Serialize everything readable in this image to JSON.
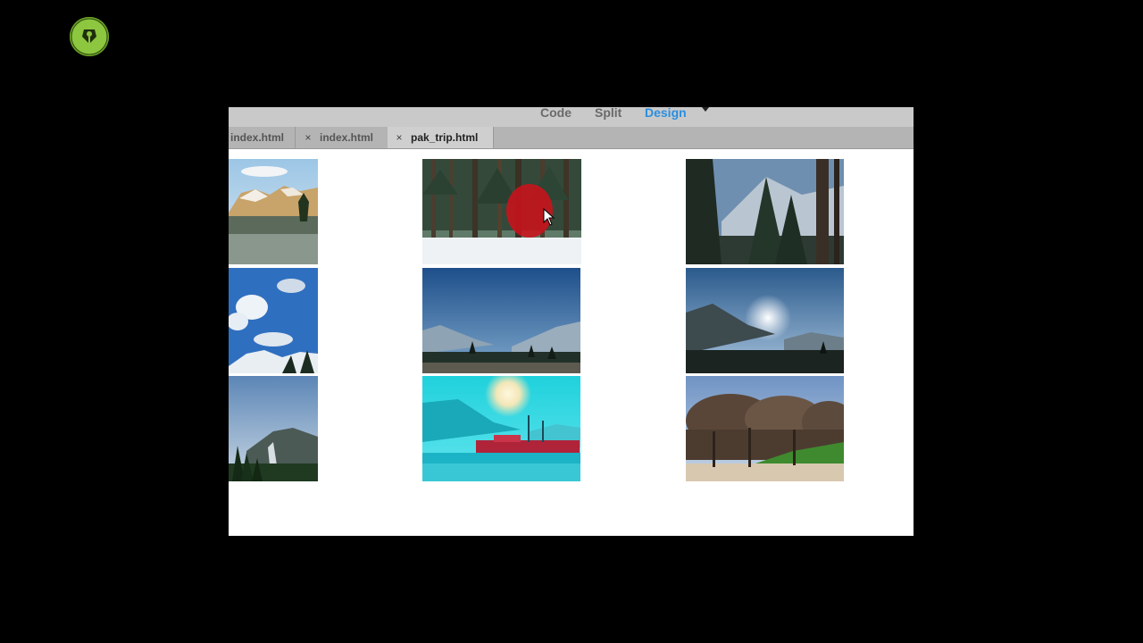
{
  "view_modes": {
    "code": "Code",
    "split": "Split",
    "design": "Design"
  },
  "tabs": [
    {
      "label": "index.html",
      "close": ""
    },
    {
      "label": "index.html",
      "close": "×"
    },
    {
      "label": "pak_trip.html",
      "close": "×"
    }
  ],
  "gallery": [
    "snowy-mountain-range",
    "pine-forest-in-snow",
    "cedar-trees-mountain",
    "blue-sky-clouds-peaks",
    "valley-under-blue-sky",
    "sun-over-mountains",
    "pine-hillside",
    "cyan-tinted-village",
    "bare-orchard-trees"
  ],
  "colors": {
    "accent": "#2a8fe0",
    "tab_bar": "#b4b4b4",
    "view_bar": "#c9c9c9",
    "logo": "#8dc63f"
  }
}
